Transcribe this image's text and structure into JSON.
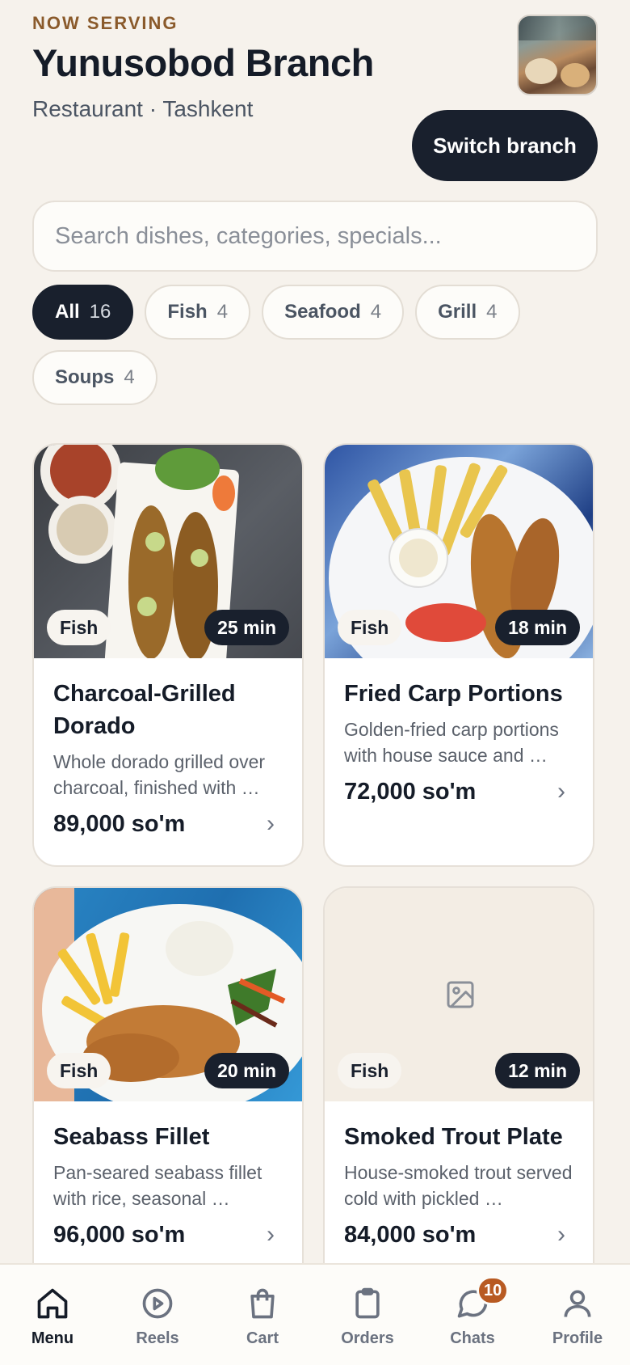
{
  "header": {
    "eyebrow": "NOW SERVING",
    "title": "Yunusobod Branch",
    "subtitle": "Restaurant · Tashkent",
    "switch_label": "Switch branch"
  },
  "search": {
    "placeholder": "Search dishes, categories, specials...",
    "value": ""
  },
  "chips": [
    {
      "label": "All",
      "count": "16",
      "active": true
    },
    {
      "label": "Fish",
      "count": "4",
      "active": false
    },
    {
      "label": "Seafood",
      "count": "4",
      "active": false
    },
    {
      "label": "Grill",
      "count": "4",
      "active": false
    },
    {
      "label": "Soups",
      "count": "4",
      "active": false
    }
  ],
  "dishes": [
    {
      "category": "Fish",
      "time": "25 min",
      "name": "Charcoal-Grilled Dorado",
      "description": "Whole dorado grilled over charcoal, finished with …",
      "price": "89,000 so'm",
      "image": "grilled-dorado-photo"
    },
    {
      "category": "Fish",
      "time": "18 min",
      "name": "Fried Carp Portions",
      "description": "Golden-fried carp portions with house sauce and …",
      "price": "72,000 so'm",
      "image": "fried-carp-photo"
    },
    {
      "category": "Fish",
      "time": "20 min",
      "name": "Seabass Fillet",
      "description": "Pan-seared seabass fillet with rice, seasonal …",
      "price": "96,000 so'm",
      "image": "seabass-fillet-photo"
    },
    {
      "category": "Fish",
      "time": "12 min",
      "name": "Smoked Trout Plate",
      "description": "House-smoked trout served cold with pickled …",
      "price": "84,000 so'm",
      "image": "image-placeholder-icon"
    }
  ],
  "nav": [
    {
      "label": "Menu",
      "icon": "home-icon",
      "active": true
    },
    {
      "label": "Reels",
      "icon": "play-circle-icon",
      "active": false
    },
    {
      "label": "Cart",
      "icon": "shopping-bag-icon",
      "active": false
    },
    {
      "label": "Orders",
      "icon": "clipboard-icon",
      "active": false
    },
    {
      "label": "Chats",
      "icon": "chat-bubble-icon",
      "active": false,
      "badge": "10"
    },
    {
      "label": "Profile",
      "icon": "user-icon",
      "active": false
    }
  ],
  "colors": {
    "background": "#f6f2ec",
    "primary_dark": "#19202d",
    "accent_brown": "#8a5a2b",
    "badge_orange": "#b85a22"
  }
}
